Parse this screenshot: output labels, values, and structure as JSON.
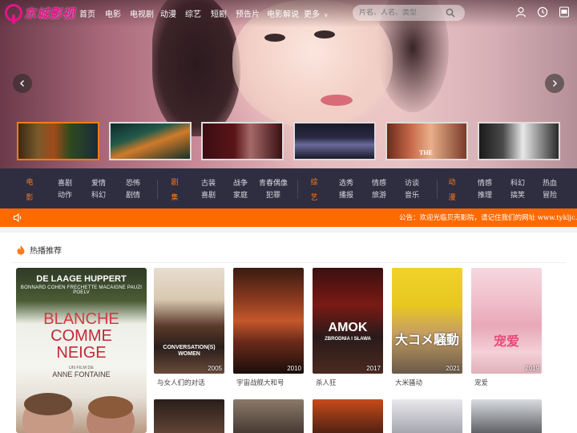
{
  "brand": {
    "name": "东城影视",
    "accent": "#e0168a"
  },
  "nav": {
    "items": [
      "首页",
      "电影",
      "电视剧",
      "动漫",
      "综艺",
      "短剧",
      "预告片",
      "电影解说"
    ],
    "more_label": "更多",
    "search_placeholder": "片名、人名、类型"
  },
  "hero": {
    "prev_icon": "chevron-left-icon",
    "next_icon": "chevron-right-icon",
    "thumb_caption": "THE"
  },
  "categories": {
    "movie": {
      "head": "电影",
      "items": [
        "喜剧",
        "爱情",
        "恐怖",
        "动作",
        "科幻",
        "剧情"
      ]
    },
    "series": {
      "head": "剧集",
      "items": [
        "古装",
        "战争",
        "青春偶像",
        "喜剧",
        "家庭",
        "犯罪"
      ]
    },
    "variety": {
      "head": "综艺",
      "items": [
        "选秀",
        "情感",
        "访谈",
        "播报",
        "旅游",
        "音乐"
      ]
    },
    "anime": {
      "head": "动漫",
      "items": [
        "情感",
        "科幻",
        "热血",
        "推理",
        "搞笑",
        "冒险"
      ]
    }
  },
  "notice": {
    "text": "公告：欢迎光临贝壳影院，请记住我们的网址 www.tykljc.com，",
    "color": "#ff6a00"
  },
  "section": {
    "title": "热播推荐"
  },
  "featured": {
    "names_top": "DE LAAGE    HUPPERT",
    "names_small": "BONNARD  COHEN  FRECHETTE  MACAIGNE  PAUZI  POELV",
    "title_lines": [
      "BLANCHE",
      "COMME",
      "NEIGE"
    ],
    "credit_small": "UN FILM DE",
    "credit_name": "ANNE FONTAINE"
  },
  "movies": [
    {
      "title": "与女人们的对话",
      "year": "2005",
      "poster_text": "CONVERSATION(S) WOMEN"
    },
    {
      "title": "宇宙战舰大和号",
      "year": "2010",
      "poster_text": ""
    },
    {
      "title": "杀人狂",
      "year": "2017",
      "poster_text": "AMOK",
      "poster_sub": "ZBRODNIA I SŁAWA"
    },
    {
      "title": "大米骚动",
      "year": "2021",
      "poster_text": "大コメ騒動"
    },
    {
      "title": "宠爱",
      "year": "2019",
      "poster_text": "宠爱"
    }
  ]
}
